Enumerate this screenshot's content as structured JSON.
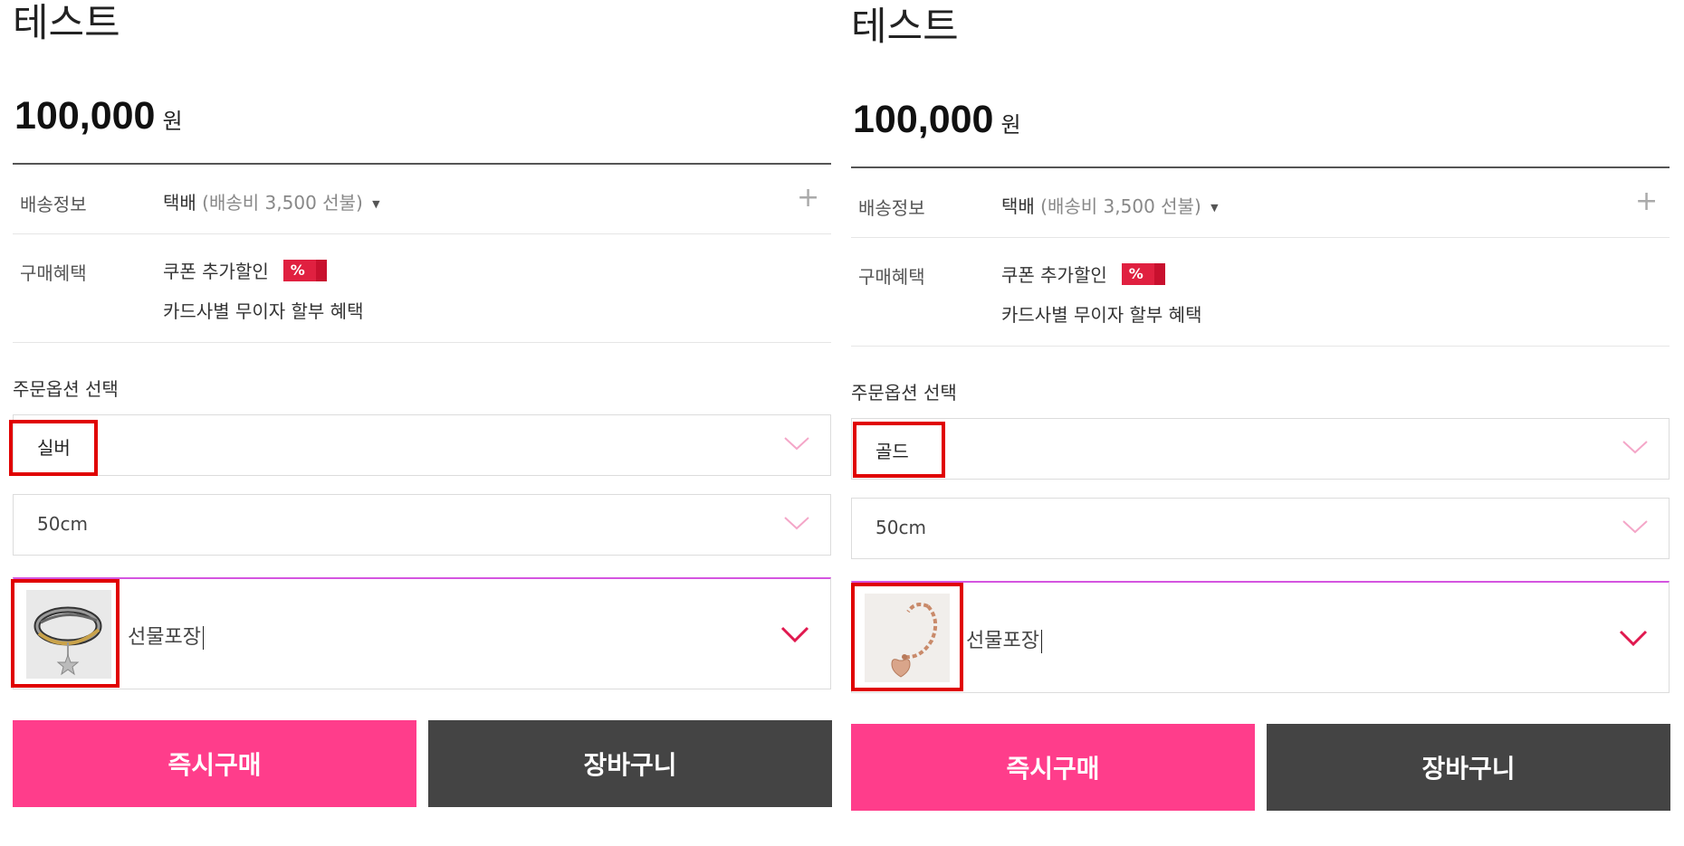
{
  "colors": {
    "buy_button": "#ff3d8b",
    "cart_button": "#444444",
    "highlight": "#e00000",
    "badge": "#e02040",
    "chevron_light": "#f4a6c8",
    "chevron_dark": "#e0194f"
  },
  "panels": [
    {
      "title": "테스트",
      "price": "100,000",
      "currency": "원",
      "shipping_label": "배송정보",
      "shipping_value": "택배",
      "shipping_detail": "(배송비 3,500 선불)",
      "benefit_label": "구매혜택",
      "benefit_coupon": "쿠폰 추가할인",
      "benefit_badge": "%",
      "benefit_card": "카드사별 무이자 할부 혜택",
      "option_heading": "주문옵션 선택",
      "color_option": "실버",
      "length_option": "50cm",
      "gift_input": "선물포장",
      "product_thumbnail_icon": "silver-bracelet-thumbnail",
      "buy_label": "즉시구매",
      "cart_label": "장바구니"
    },
    {
      "title": "테스트",
      "price": "100,000",
      "currency": "원",
      "shipping_label": "배송정보",
      "shipping_value": "택배",
      "shipping_detail": "(배송비 3,500 선불)",
      "benefit_label": "구매혜택",
      "benefit_coupon": "쿠폰 추가할인",
      "benefit_badge": "%",
      "benefit_card": "카드사별 무이자 할부 혜택",
      "option_heading": "주문옵션 선택",
      "color_option": "골드",
      "length_option": "50cm",
      "gift_input": "선물포장",
      "product_thumbnail_icon": "gold-bracelet-thumbnail",
      "buy_label": "즉시구매",
      "cart_label": "장바구니"
    }
  ]
}
